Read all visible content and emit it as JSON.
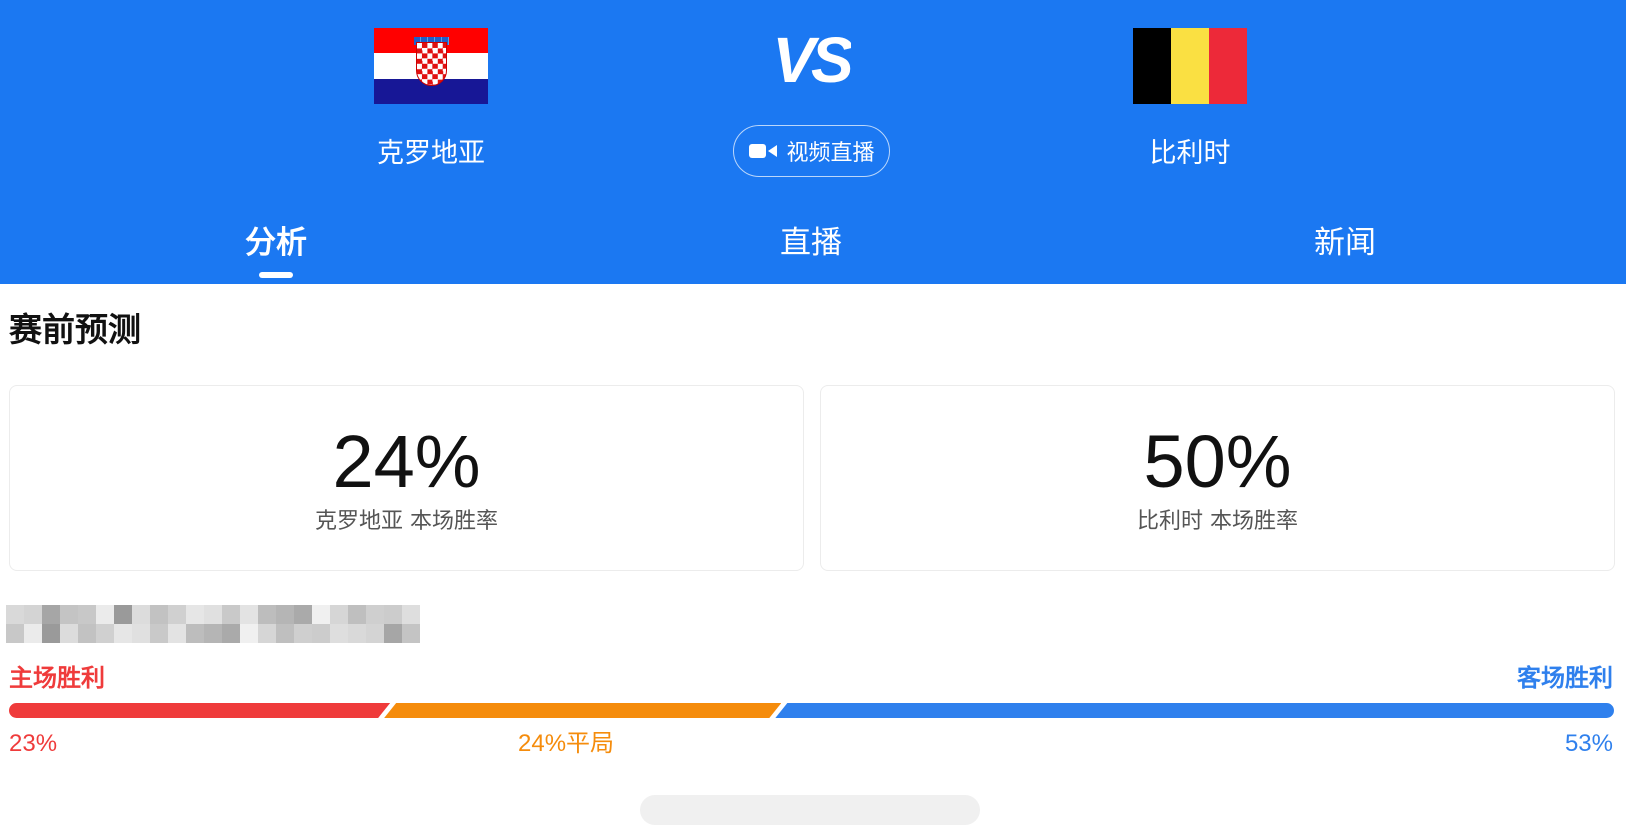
{
  "header": {
    "home_team": {
      "name": "克罗地亚",
      "flag_icon": "croatia-flag"
    },
    "away_team": {
      "name": "比利时",
      "flag_icon": "belgium-flag"
    },
    "vs_text": "VS",
    "live_button": {
      "label": "视频直播",
      "icon": "video-camera-icon"
    },
    "colors": {
      "background": "#1b78f2",
      "text": "#ffffff"
    }
  },
  "tabs": [
    {
      "label": "分析",
      "active": true
    },
    {
      "label": "直播",
      "active": false
    },
    {
      "label": "新闻",
      "active": false
    }
  ],
  "prediction": {
    "title": "赛前预测",
    "home": {
      "percent": "24%",
      "label": "克罗地亚 本场胜率"
    },
    "away": {
      "percent": "50%",
      "label": "比利时 本场胜率"
    }
  },
  "outcome_bar": {
    "home_label": "主场胜利",
    "away_label": "客场胜利",
    "home_value": "23%",
    "draw_value": "24%平局",
    "away_value": "53%",
    "home_fraction": 0.23,
    "draw_fraction": 0.24,
    "away_fraction": 0.53,
    "colors": {
      "home": "#ef3b3b",
      "draw": "#f58c0c",
      "away": "#2f80ed"
    }
  }
}
